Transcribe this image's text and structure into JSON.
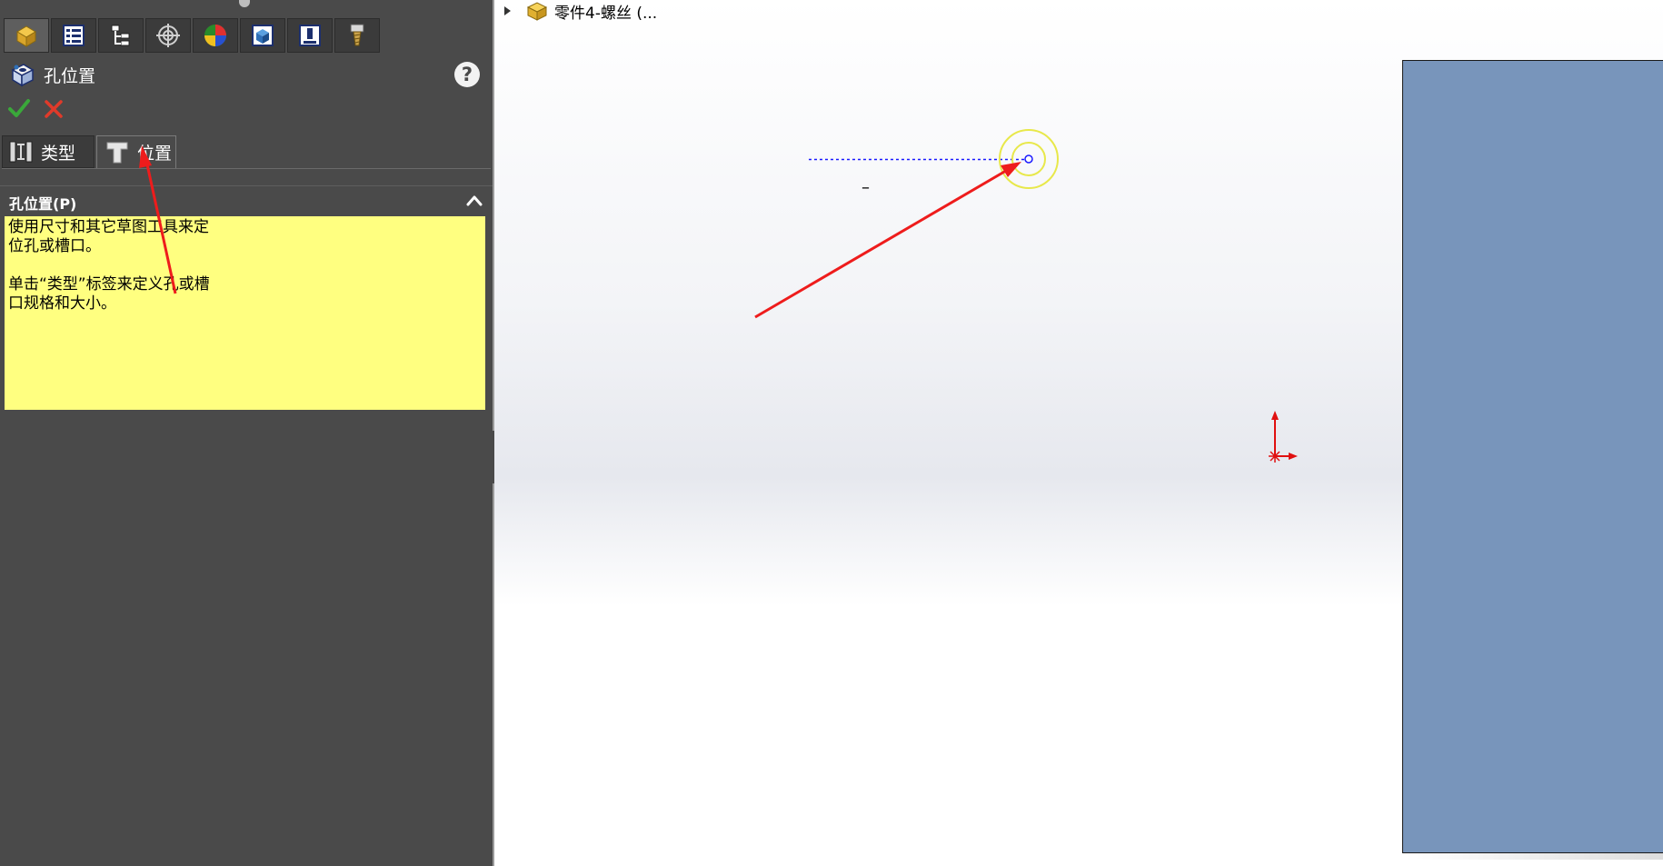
{
  "manager_tabs": [
    {
      "icon": "feature-manager-icon",
      "active": true
    },
    {
      "icon": "property-manager-icon",
      "active": false
    },
    {
      "icon": "configuration-manager-icon",
      "active": false
    },
    {
      "icon": "dimxpert-manager-icon",
      "active": false
    },
    {
      "icon": "display-manager-icon",
      "active": false
    },
    {
      "icon": "cam-feature-manager-icon",
      "active": false
    },
    {
      "icon": "cam-operation-manager-icon",
      "active": false
    },
    {
      "icon": "cam-tool-manager-icon",
      "active": false
    }
  ],
  "property_manager": {
    "title": "孔位置",
    "help_label": "?",
    "ok_icon": "check-icon",
    "cancel_icon": "x-icon",
    "tabs": [
      {
        "label": "类型",
        "icon": "hole-type-icon"
      },
      {
        "label": "位置",
        "icon": "hole-position-icon"
      }
    ],
    "section": {
      "title": "孔位置(P)",
      "message_lines": [
        "使用尺寸和其它草图工具来定",
        "位孔或槽口。",
        "",
        "单击“类型”标签来定义孔或槽",
        "口规格和大小。"
      ]
    }
  },
  "graphics": {
    "tree_node_label": "零件4-螺丝 (...",
    "dimension_text": "–",
    "colors": {
      "plate": "#7895bb",
      "panel": "#4a4a4a",
      "message_bg": "#ffff80",
      "annotation_arrow": "#ee1c1c",
      "highlight": "#e8e84a",
      "construction_line": "#1a1aff"
    }
  }
}
